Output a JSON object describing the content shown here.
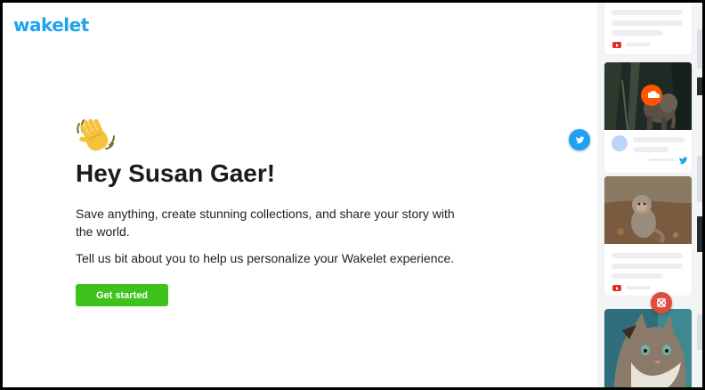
{
  "brand": {
    "logo_text": "wakelet",
    "color": "#1fa3ec"
  },
  "welcome": {
    "wave_icon": "waving-hand-icon",
    "greeting": "Hey Susan Gaer!",
    "line1": "Save anything, create stunning collections, and share your story with the world.",
    "line2": "Tell us bit about you to help us personalize your Wakelet experience.",
    "cta_label": "Get started",
    "cta_color": "#3dc31b"
  },
  "feed": {
    "cards": [
      {
        "type": "text",
        "source_icon": "youtube-icon"
      },
      {
        "type": "image",
        "image": "elephant-forest-photo",
        "source_icon": "soundcloud-icon"
      },
      {
        "type": "profile",
        "source_icon": "twitter-icon"
      },
      {
        "type": "image",
        "image": "monkey-photo",
        "source_icon": "youtube-icon"
      },
      {
        "type": "image",
        "image": "cat-photo",
        "source_icon": "pinterest-icon"
      }
    ],
    "colors": {
      "twitter": "#1da1f2",
      "youtube": "#e52d27",
      "soundcloud": "#ff5500",
      "pinterest": "#e04b3f"
    }
  }
}
